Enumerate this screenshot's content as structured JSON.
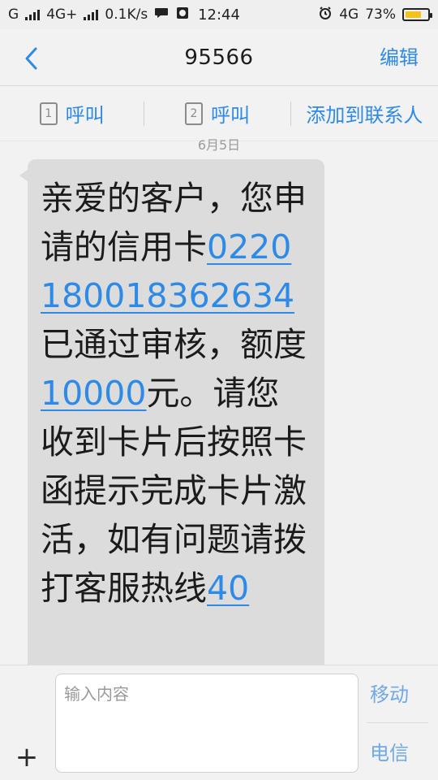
{
  "status_bar": {
    "left": {
      "carrier_g": "G",
      "network": "4G+",
      "speed": "0.1K/s"
    },
    "time": "12:44",
    "right": {
      "network": "4G",
      "battery_percent": "73%",
      "battery_level": 0.73
    }
  },
  "header": {
    "title": "95566",
    "edit_label": "编辑"
  },
  "actions": {
    "call1_sim": "1",
    "call1_label": "呼叫",
    "call2_sim": "2",
    "call2_label": "呼叫",
    "add_contact_label": "添加到联系人"
  },
  "conversation": {
    "date": "6月5日",
    "message": {
      "part1": "亲爱的客户，您申请的信用卡",
      "card_number": "0220180018362634",
      "part2": "已通过审核，额度",
      "amount": "10000",
      "part3": "元。请您收到卡片后按照卡函提示完成卡片激活，如有问题请拨打客服热线",
      "hotline_partial": "40"
    }
  },
  "composer": {
    "placeholder": "输入内容",
    "sim_top": "移动",
    "sim_bottom": "电信"
  },
  "colors": {
    "accent": "#2d8ae6",
    "bubble": "#dcdcdc",
    "background": "#f2f2f2"
  }
}
